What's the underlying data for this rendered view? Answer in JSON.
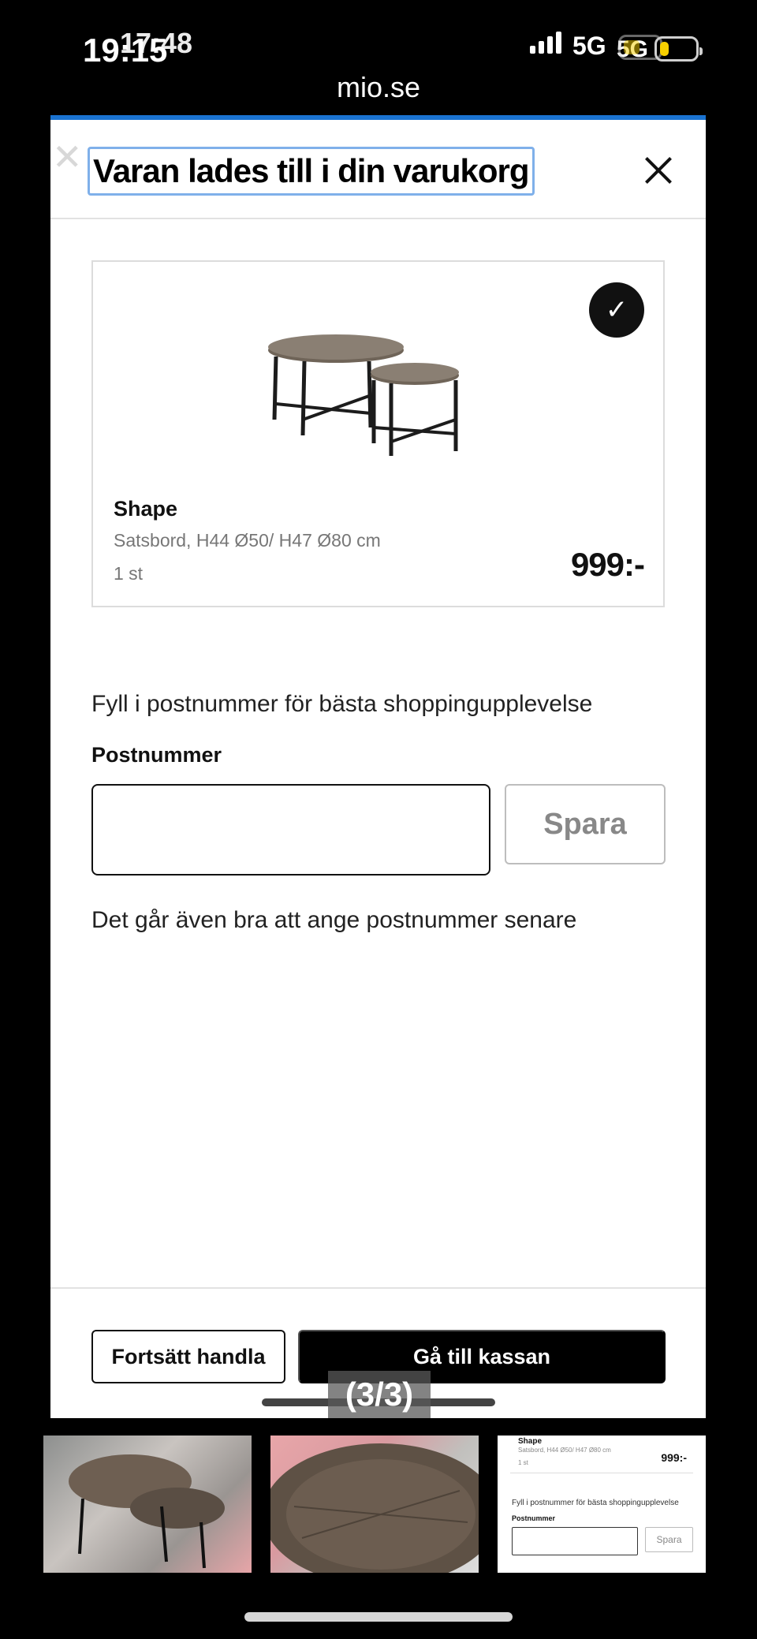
{
  "status_bar": {
    "time_primary": "19:15",
    "time_secondary": "17:48",
    "network_primary": "5G",
    "network_secondary": "5G",
    "battery_level": 0.25,
    "battery_color": "#f7d000"
  },
  "browser": {
    "url": "mio.se"
  },
  "modal": {
    "accent_color": "#1a73d1",
    "title": "Varan lades till i din varukorg",
    "close_icon": "close-icon"
  },
  "product": {
    "name": "Shape",
    "description": "Satsbord, H44 Ø50/ H47 Ø80 cm",
    "quantity": "1 st",
    "price": "999:-",
    "added_icon": "checkmark-icon"
  },
  "postcode": {
    "info": "Fyll i postnummer för bästa shoppingupplevelse",
    "label": "Postnummer",
    "value": "",
    "placeholder": "",
    "save_label": "Spara",
    "later_note": "Det går även bra att ange postnummer senare"
  },
  "actions": {
    "continue_label": "Fortsätt handla",
    "checkout_label": "Gå till kassan"
  },
  "gallery": {
    "counter": "(3/3)",
    "thumb3": {
      "name": "Shape",
      "description": "Satsbord, H44 Ø50/ H47 Ø80 cm",
      "quantity": "1 st",
      "price": "999:-",
      "info": "Fyll i postnummer för bästa shoppingupplevelse",
      "label": "Postnummer",
      "save_label": "Spara"
    }
  }
}
